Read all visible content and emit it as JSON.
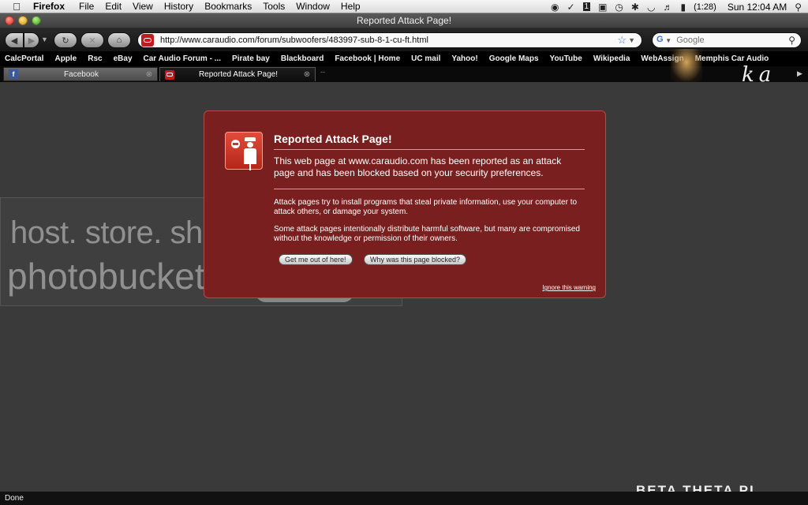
{
  "menubar": {
    "apple_icon": "",
    "app_name": "Firefox",
    "menus": [
      "File",
      "Edit",
      "View",
      "History",
      "Bookmarks",
      "Tools",
      "Window",
      "Help"
    ],
    "battery": "(1:28)",
    "clock": "Sun 12:04 AM",
    "icons": [
      "spotify-icon",
      "growl-icon",
      "one-icon",
      "display-icon",
      "time-machine-icon",
      "bluetooth-icon",
      "wifi-icon",
      "volume-icon",
      "battery-icon",
      "spotlight-icon"
    ]
  },
  "window": {
    "title": "Reported Attack Page!"
  },
  "toolbar": {
    "url": "http://www.caraudio.com/forum/subwoofers/483997-sub-8-1-cu-ft.html",
    "search_placeholder": "Google"
  },
  "bookmarks": [
    "CalcPortal",
    "Apple",
    "Rsc",
    "eBay",
    "Car Audio Forum - ...",
    "Pirate bay",
    "Blackboard",
    "Facebook | Home",
    "UC mail",
    "Yahoo!",
    "Google Maps",
    "YouTube",
    "Wikipedia",
    "WebAssign",
    "Memphis Car Audio"
  ],
  "tabs": [
    {
      "label": "Facebook"
    },
    {
      "label": "Reported Attack Page!"
    }
  ],
  "error": {
    "title": "Reported Attack Page!",
    "short_desc": "This web page at www.caraudio.com has been reported as an attack page and has been blocked based on your security preferences.",
    "long_desc_1": "Attack pages try to install programs that steal private information, use your computer to attack others, or damage your system.",
    "long_desc_2": "Some attack pages intentionally distribute harmful software, but many are compromised without the knowledge or permission of their owners.",
    "get_out_label": "Get me out of here!",
    "why_label": "Why was this page blocked?",
    "ignore_label": "Ignore this warning"
  },
  "watermark": {
    "line1": "host. store. share.",
    "line2": "photobucket"
  },
  "status": "Done"
}
